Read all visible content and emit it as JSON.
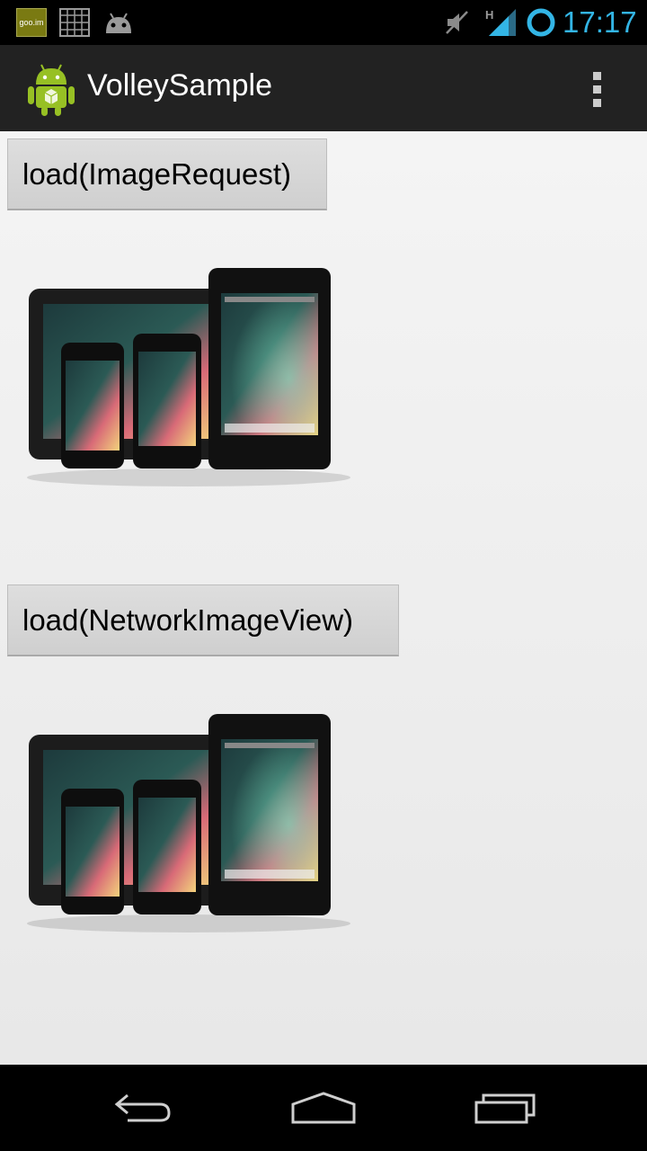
{
  "status_bar": {
    "notification_icons": [
      "goo-im-icon",
      "grid-icon",
      "android-icon"
    ],
    "goo_label": "goo.im",
    "system_icons": [
      "mute-icon",
      "signal-icon",
      "sync-icon"
    ],
    "network_type": "H",
    "time": "17:17",
    "accent_color": "#33b5e5"
  },
  "action_bar": {
    "title": "VolleySample",
    "app_icon": "android-robot-icon",
    "overflow_icon": "overflow-menu-icon"
  },
  "buttons": {
    "image_request": "load(ImageRequest)",
    "network_image_view": "load(NetworkImageView)"
  },
  "images": {
    "first": "nexus-devices-image",
    "second": "nexus-devices-image"
  },
  "navigation_bar": {
    "back": "back-icon",
    "home": "home-icon",
    "recents": "recents-icon"
  }
}
